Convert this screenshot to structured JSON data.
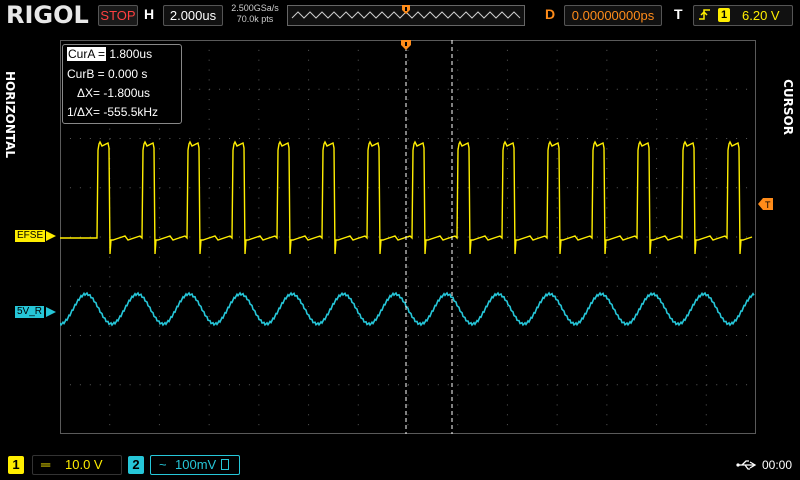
{
  "header": {
    "logo": "RIGOL",
    "run_state": "STOP",
    "timebase_label": "H",
    "timebase_value": "2.000us",
    "sample_rate": "2.500GSa/s",
    "memory_depth": "70.0k pts",
    "delay_label": "D",
    "delay_value": "0.00000000ps",
    "trigger_label": "T",
    "trigger_source": "1",
    "trigger_level": "6.20 V"
  },
  "side": {
    "left_menu": "HORIZONTAL",
    "right_menu": "CURSOR"
  },
  "cursor": {
    "cur_a_label": "CurA =",
    "cur_a_value": "1.800us",
    "cur_b": "CurB =  0.000 s",
    "delta_x": "ΔX=  -1.800us",
    "inv_delta_x": "1/ΔX=  -555.5kHz"
  },
  "channels": [
    {
      "num": "1",
      "label": "EFSE",
      "coupling": "═",
      "scale": "10.0 V",
      "color": "#ffee00"
    },
    {
      "num": "2",
      "label": "5V_R",
      "coupling": "~",
      "scale": "100mV",
      "color": "#26c6d8"
    }
  ],
  "status": {
    "clock": "00:00"
  },
  "colors": {
    "ch1": "#ffee00",
    "ch2": "#26c6d8",
    "delay": "#ff8c1a",
    "grid": "#5a5a5a",
    "cursor": "#ffffff"
  },
  "icons": [
    "trigger-position-marker-icon",
    "trigger-level-marker-icon",
    "usb-icon",
    "rising-edge-icon",
    "lock-icon"
  ]
}
